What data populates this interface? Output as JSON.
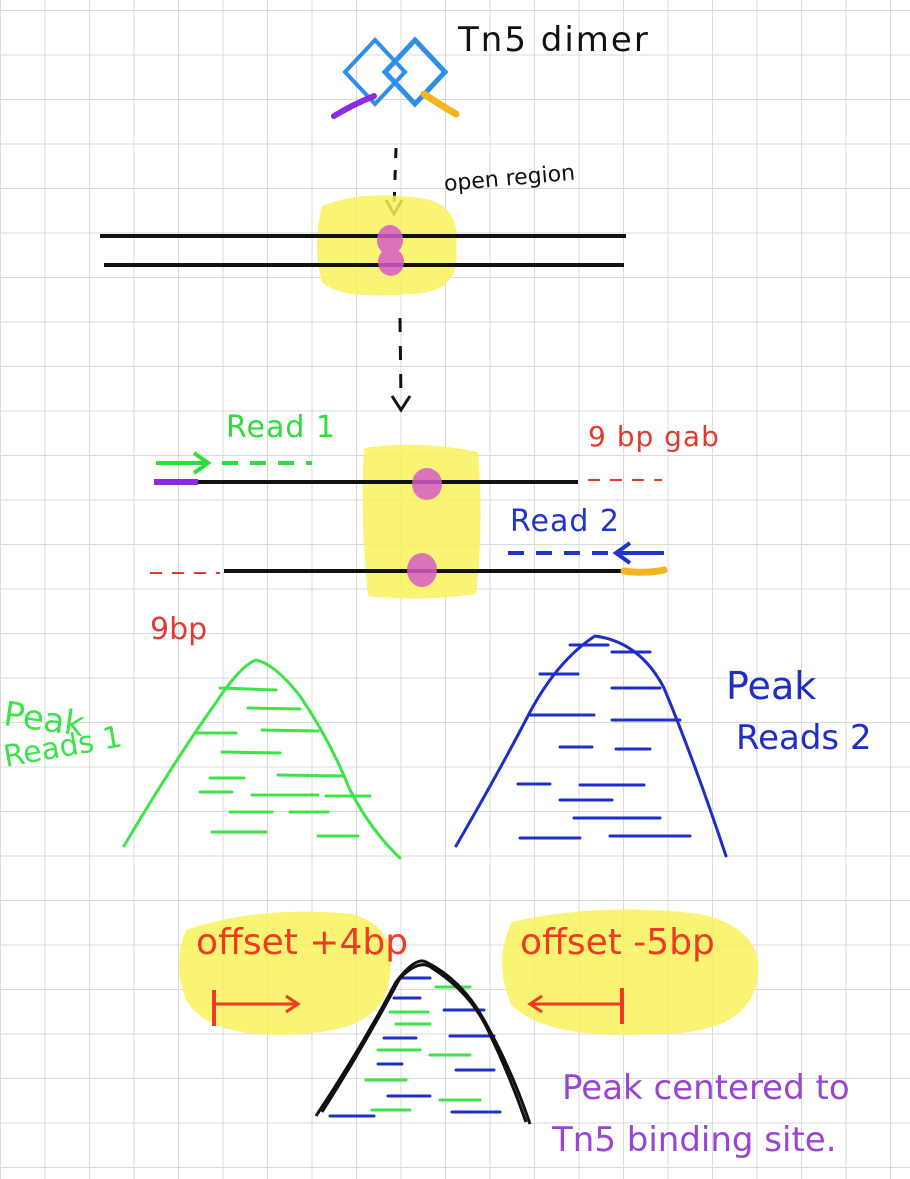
{
  "labels": {
    "tn5_dimer": "Tn5 dimer",
    "open_region": "open region",
    "read1": "Read 1",
    "gap_9bp_top": "9 bp gab",
    "read2": "Read 2",
    "gap_9bp_bottom": "9bp",
    "peak_reads1_line1": "Peak",
    "peak_reads1_line2": "Reads 1",
    "peak_reads2_line1": "Peak",
    "peak_reads2_line2": "Reads 2",
    "offset_plus": "offset +4bp",
    "offset_minus": "offset -5bp",
    "centered_line1": "Peak centered to",
    "centered_line2": "Tn5 binding site."
  },
  "colors": {
    "reads1": "#2fdc3a",
    "reads2": "#1f35cc",
    "gap": "#e23a2e",
    "offset": "#ef3a24",
    "highlight": "#f8f25a",
    "binding": "#d65bc7",
    "centered": "#9a45d2",
    "dimer_outline": "#2f8ee8",
    "adapter_purple": "#8a2be2",
    "adapter_orange": "#f2b51f",
    "dna": "#111111"
  }
}
